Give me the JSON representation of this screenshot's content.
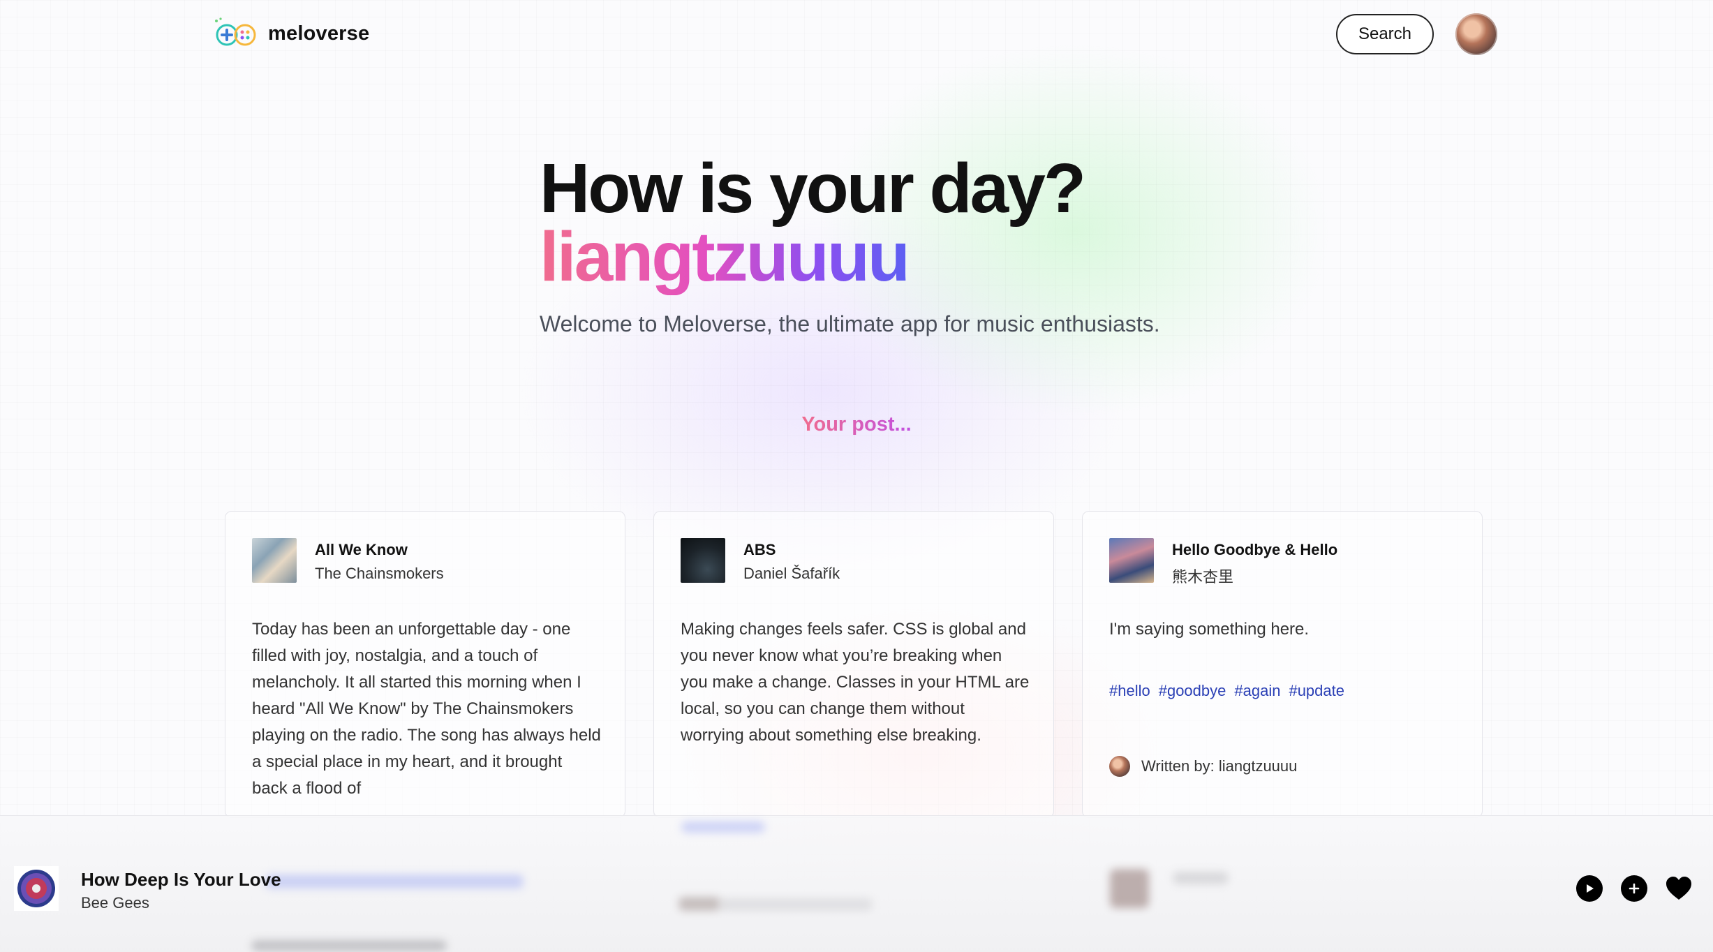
{
  "header": {
    "app_name": "meloverse",
    "search_label": "Search"
  },
  "hero": {
    "title": "How is your day?",
    "username": "liangtzuuuu",
    "subtitle": "Welcome to Meloverse, the ultimate app for music enthusiasts."
  },
  "section_label": "Your post...",
  "cards": [
    {
      "title": "All We Know",
      "artist": "The Chainsmokers",
      "body": "Today has been an unforgettable day - one filled with joy, nostalgia, and a touch of melancholy. It all started this morning when I heard \"All We Know\" by The Chainsmokers playing on the radio. The song has always held a special place in my heart, and it brought back a flood of"
    },
    {
      "title": "ABS",
      "artist": "Daniel Šafařík",
      "body": "Making changes feels safer. CSS is global and you never know what you’re breaking when you make a change. Classes in your HTML are local, so you can change them without worrying about something else breaking."
    },
    {
      "title": "Hello Goodbye & Hello",
      "artist": "熊木杏里",
      "body": "I'm saying something here.",
      "tags": [
        "#hello",
        "#goodbye",
        "#again",
        "#update"
      ],
      "written_by": "Written by: liangtzuuuu"
    }
  ],
  "player": {
    "title": "How Deep Is Your Love",
    "artist": "Bee Gees"
  },
  "colors": {
    "accent_pink": "#f06c8e",
    "accent_purple": "#8c4ff0",
    "tag_blue": "#2a3fb5"
  },
  "icons": [
    "logo-icon",
    "play-icon",
    "add-icon",
    "heart-icon"
  ]
}
